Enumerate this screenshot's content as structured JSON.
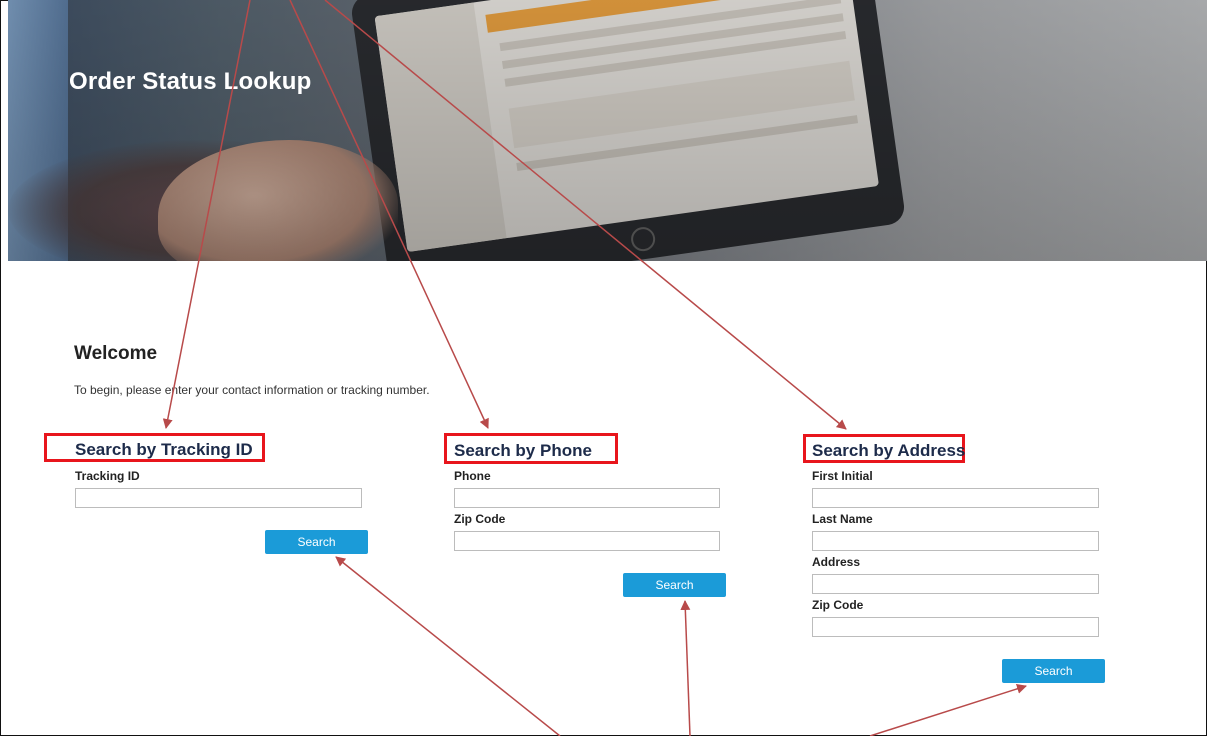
{
  "hero": {
    "title": "Order Status Lookup"
  },
  "welcome": {
    "heading": "Welcome",
    "intro": "To begin, please enter your contact information or tracking number."
  },
  "tracking": {
    "title": "Search by Tracking ID",
    "fields": [
      {
        "label": "Tracking ID",
        "value": ""
      }
    ],
    "button": "Search"
  },
  "phone": {
    "title": "Search by Phone",
    "fields": [
      {
        "label": "Phone",
        "value": ""
      },
      {
        "label": "Zip Code",
        "value": ""
      }
    ],
    "button": "Search"
  },
  "address": {
    "title": "Search by Address",
    "fields": [
      {
        "label": "First Initial",
        "value": ""
      },
      {
        "label": "Last Name",
        "value": ""
      },
      {
        "label": "Address",
        "value": ""
      },
      {
        "label": "Zip Code",
        "value": ""
      }
    ],
    "button": "Search"
  },
  "colors": {
    "highlight": "#e8151c",
    "arrow": "#b84a4a",
    "button": "#1b9bd8"
  }
}
